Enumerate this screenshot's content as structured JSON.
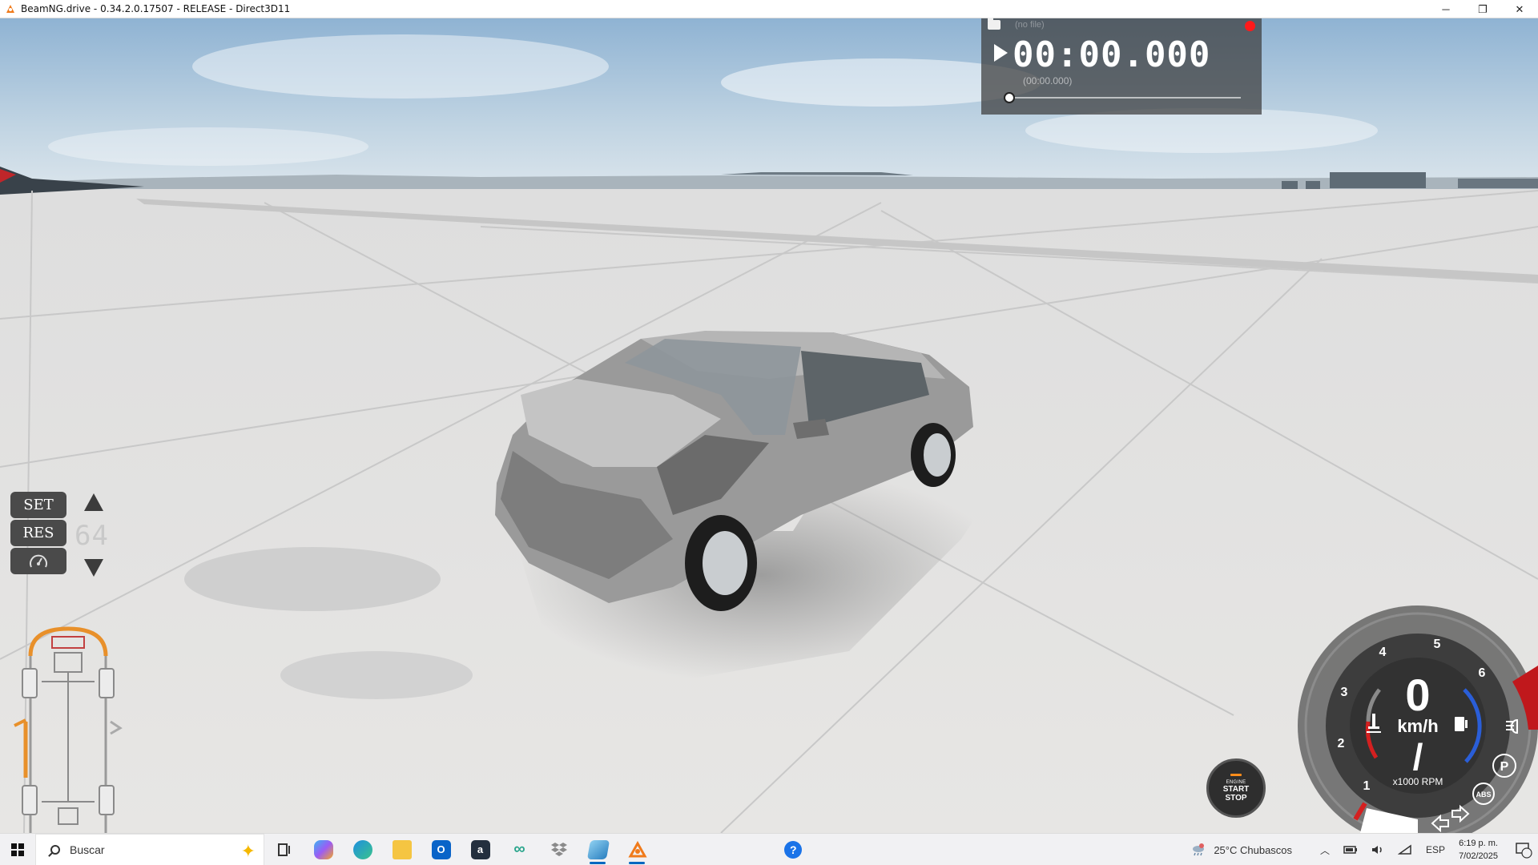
{
  "window": {
    "title": "BeamNG.drive - 0.34.2.0.17507 - RELEASE - Direct3D11",
    "minimize_glyph": "─",
    "maximize_glyph": "❐",
    "close_glyph": "✕"
  },
  "replay": {
    "filename": "(no file)",
    "time": "00:00.000",
    "subtime": "(00:00.000)",
    "position": 0
  },
  "cruise_control": {
    "set_label": "SET",
    "res_label": "RES",
    "speed": "64"
  },
  "engine_button": {
    "line1": "ENGINE",
    "line2": "START",
    "line3": "STOP",
    "indicator_color": "#ff8c1a"
  },
  "dashboard": {
    "speed": "0",
    "speed_unit": "km/h",
    "gear": "/",
    "rpm_label": "x1000 RPM",
    "rpm_ticks": [
      "1",
      "2",
      "3",
      "4",
      "5",
      "6"
    ],
    "parking_brake": "P",
    "abs_label": "ABS",
    "redline_color": "#c0181c",
    "temp_color": "#d42020",
    "fuel_color": "#2a5ed8"
  },
  "taskbar": {
    "search_placeholder": "Buscar",
    "apps": [
      {
        "name": "task-view",
        "label": ""
      },
      {
        "name": "copilot",
        "label": ""
      },
      {
        "name": "edge",
        "label": ""
      },
      {
        "name": "file-explorer",
        "label": ""
      },
      {
        "name": "outlook",
        "label": "O"
      },
      {
        "name": "amazon",
        "label": "a"
      },
      {
        "name": "infinity",
        "label": "∞"
      },
      {
        "name": "dropbox",
        "label": ""
      },
      {
        "name": "app-blue",
        "label": ""
      },
      {
        "name": "beamng",
        "label": ""
      }
    ],
    "help_label": "?",
    "weather": "25°C  Chubascos",
    "language": "ESP",
    "time": "6:19 p. m.",
    "date": "7/02/2025",
    "notification_count": "1"
  }
}
